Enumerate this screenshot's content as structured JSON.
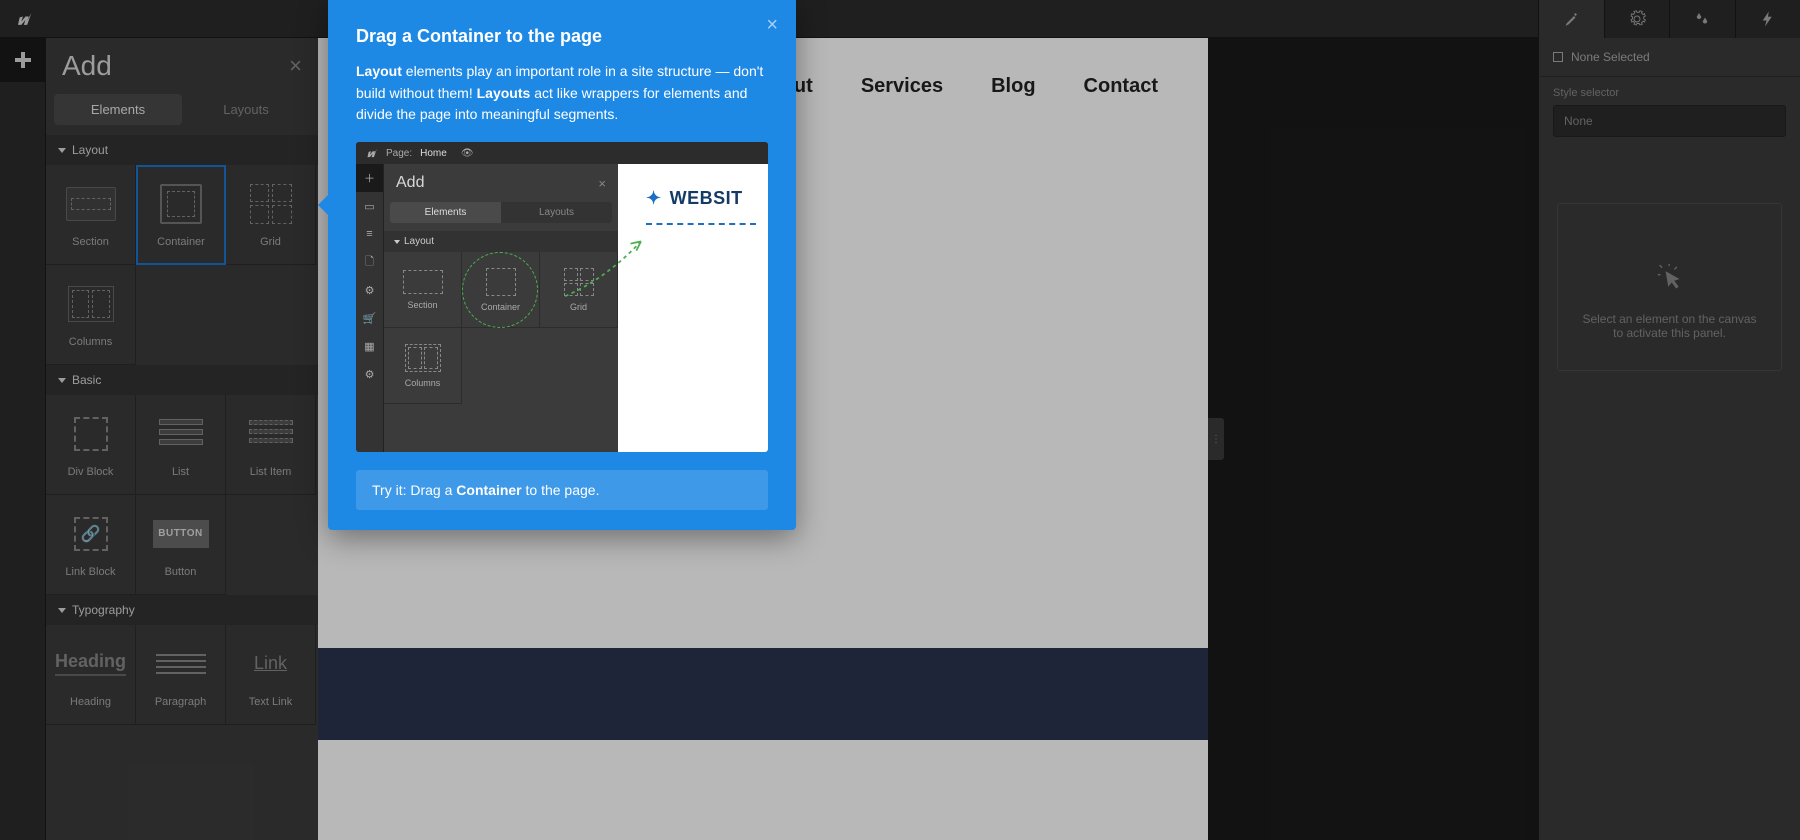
{
  "topbar": {},
  "addPanel": {
    "title": "Add",
    "tabs": {
      "elements": "Elements",
      "layouts": "Layouts"
    },
    "sections": {
      "layout": {
        "title": "Layout",
        "items": {
          "section": "Section",
          "container": "Container",
          "grid": "Grid",
          "columns": "Columns"
        }
      },
      "basic": {
        "title": "Basic",
        "items": {
          "divblock": "Div Block",
          "list": "List",
          "listitem": "List Item",
          "linkblock": "Link Block",
          "button": "Button",
          "buttonIconText": "BUTTON"
        }
      },
      "typography": {
        "title": "Typography",
        "items": {
          "heading": "Heading",
          "headingIconText": "Heading",
          "paragraph": "Paragraph",
          "textlink": "Text Link",
          "textlinkIconText": "Link"
        }
      }
    }
  },
  "canvas": {
    "nav": {
      "about": "About",
      "services": "Services",
      "blog": "Blog",
      "contact": "Contact"
    }
  },
  "rightPanel": {
    "noneSelected": "None Selected",
    "styleSelectorLabel": "Style selector",
    "styleSelectorValue": "None",
    "emptyLine1": "Select an element on the canvas",
    "emptyLine2": "to activate this panel."
  },
  "tooltip": {
    "title": "Drag a Container to the page",
    "para_layout_bold": "Layout",
    "para_text1": " elements play an important role in a site structure — don't build without them! ",
    "para_layouts_bold": "Layouts",
    "para_text2": " act like wrappers for elements and divide the page into meaningful segments.",
    "tryPrefix": "Try it: Drag a ",
    "tryBold": "Container",
    "trySuffix": " to the page.",
    "mock": {
      "pageLabel": "Page:",
      "pageName": "Home",
      "addTitle": "Add",
      "tabElements": "Elements",
      "tabLayouts": "Layouts",
      "secLayout": "Layout",
      "section": "Section",
      "container": "Container",
      "grid": "Grid",
      "columns": "Columns",
      "siteTitle": "WEBSIT"
    }
  }
}
